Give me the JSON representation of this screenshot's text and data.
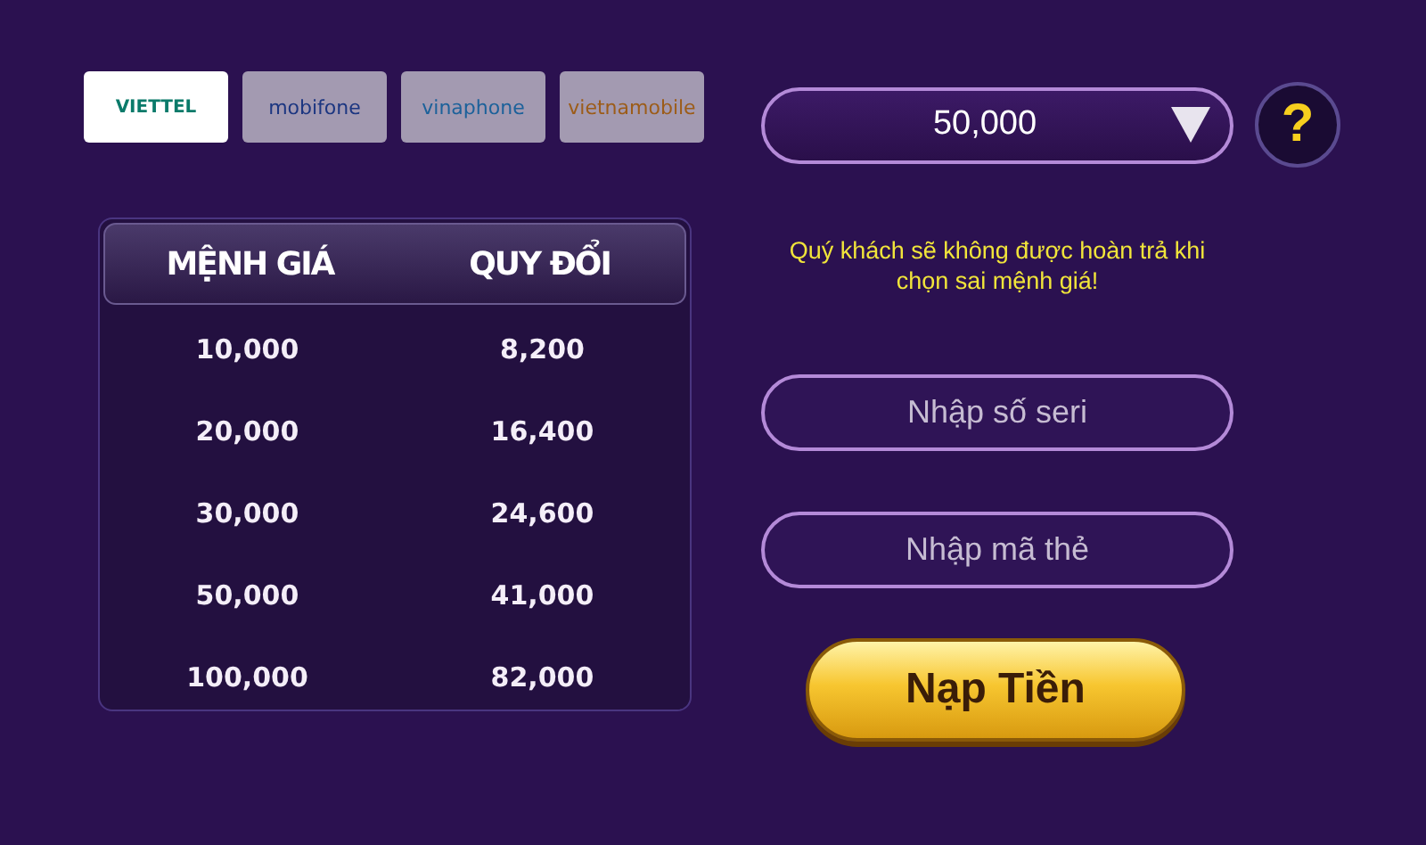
{
  "carriers": [
    {
      "name": "VIETTEL",
      "selected": true
    },
    {
      "name": "mobifone",
      "selected": false
    },
    {
      "name": "vinaphone",
      "selected": false
    },
    {
      "name": "vietnamobile",
      "selected": false
    }
  ],
  "rate_table": {
    "columns": [
      "MỆNH GIÁ",
      "QUY ĐỔI"
    ],
    "rows": [
      [
        "10,000",
        "8,200"
      ],
      [
        "20,000",
        "16,400"
      ],
      [
        "30,000",
        "24,600"
      ],
      [
        "50,000",
        "41,000"
      ],
      [
        "100,000",
        "82,000"
      ]
    ]
  },
  "amount_select": {
    "value": "50,000"
  },
  "help_button": {
    "label": "?"
  },
  "warning": "Quý khách sẽ không được hoàn trả khi chọn sai mệnh giá!",
  "serial_field": {
    "placeholder": "Nhập số seri"
  },
  "code_field": {
    "placeholder": "Nhập mã thẻ"
  },
  "submit_button": {
    "label": "Nạp Tiền"
  }
}
